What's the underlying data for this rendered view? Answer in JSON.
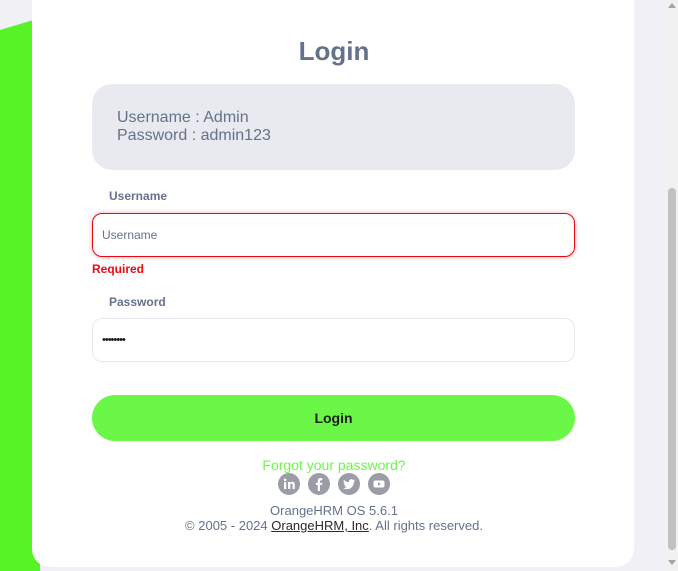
{
  "login": {
    "title": "Login",
    "credentials_hint": {
      "username_line": "Username : Admin",
      "password_line": "Password : admin123"
    },
    "username": {
      "label": "Username",
      "placeholder": "Username",
      "value": "",
      "error": "Required"
    },
    "password": {
      "label": "Password",
      "masked_value": "••••••••"
    },
    "submit_label": "Login",
    "forgot_password_link": "Forgot your password?"
  },
  "social_icons": [
    "linkedin-icon",
    "facebook-icon",
    "twitter-icon",
    "youtube-icon"
  ],
  "footer": {
    "version": "OrangeHRM OS 5.6.1",
    "copyright_prefix": "© 2005 - 2024 ",
    "company_link": "OrangeHRM, Inc",
    "copyright_suffix": ". All rights reserved."
  },
  "colors": {
    "accent_green": "#6bf748",
    "left_green_bg": "#56f327",
    "error_red": "#eb0910",
    "text_gray": "#64728c"
  }
}
